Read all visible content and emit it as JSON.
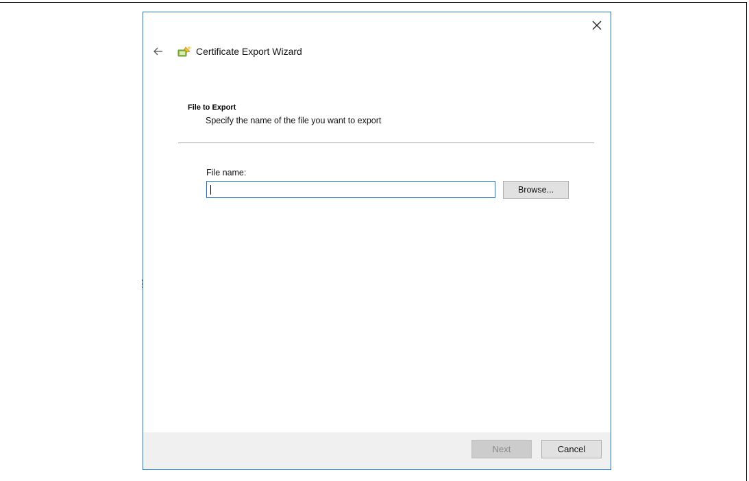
{
  "dialog": {
    "close_icon": "close-icon",
    "back_icon": "back-arrow-icon",
    "wizard_icon": "certificate-wizard-icon",
    "title": "Certificate Export Wizard"
  },
  "section": {
    "title": "File to Export",
    "description": "Specify the name of the file you want to export"
  },
  "file_field": {
    "label": "File name:",
    "value": "",
    "browse_label": "Browse..."
  },
  "footer": {
    "next_label": "Next",
    "cancel_label": "Cancel"
  },
  "colors": {
    "accent_border": "#1a73c7",
    "footer_bg": "#f0f0f0",
    "disabled_button_bg": "#cccccc",
    "button_bg": "#e1e1e1"
  }
}
